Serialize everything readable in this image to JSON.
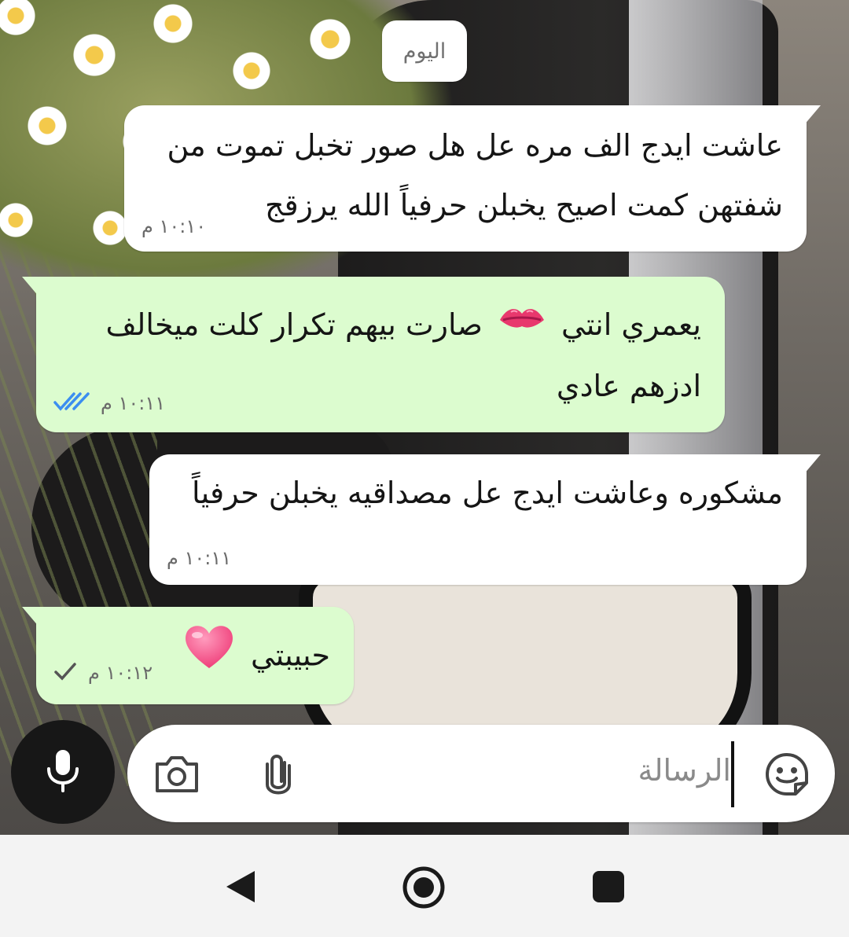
{
  "chat": {
    "date_label": "اليوم",
    "messages": [
      {
        "direction": "incoming",
        "lines": [
          "عاشت ايدج الف مره عل هل صور تخبل تموت من",
          "شفتهن كمت اصيح يخبلن حرفياً الله يرزقج"
        ],
        "time": "١٠:١٠ م"
      },
      {
        "direction": "outgoing",
        "line1_a": "يعمري انتي",
        "emoji1": "kiss-mark-icon",
        "line1_b": "صارت بيهم تكرار كلت ميخالف",
        "line2": "ادزهم عادي",
        "time": "١٠:١١ م",
        "status": "read-double-check"
      },
      {
        "direction": "incoming",
        "lines": [
          "مشكوره وعاشت ايدج عل مصداقيه يخبلن حرفياً"
        ],
        "time": "١٠:١١ م"
      },
      {
        "direction": "outgoing",
        "text": "حبيبتي",
        "emoji1": "pink-heart-icon",
        "time": "١٠:١٢ م",
        "status": "sent-single-check"
      }
    ]
  },
  "composer": {
    "placeholder": "الرسالة",
    "icons": [
      "sticker-icon",
      "attachment-icon",
      "camera-icon",
      "microphone-icon"
    ]
  },
  "colors": {
    "incoming_bubble": "#ffffff",
    "outgoing_bubble": "#dcfccf",
    "read_tick": "#3b8ef0",
    "mic_button": "#171717"
  },
  "navigation": {
    "buttons": [
      "back",
      "home",
      "recents"
    ]
  }
}
